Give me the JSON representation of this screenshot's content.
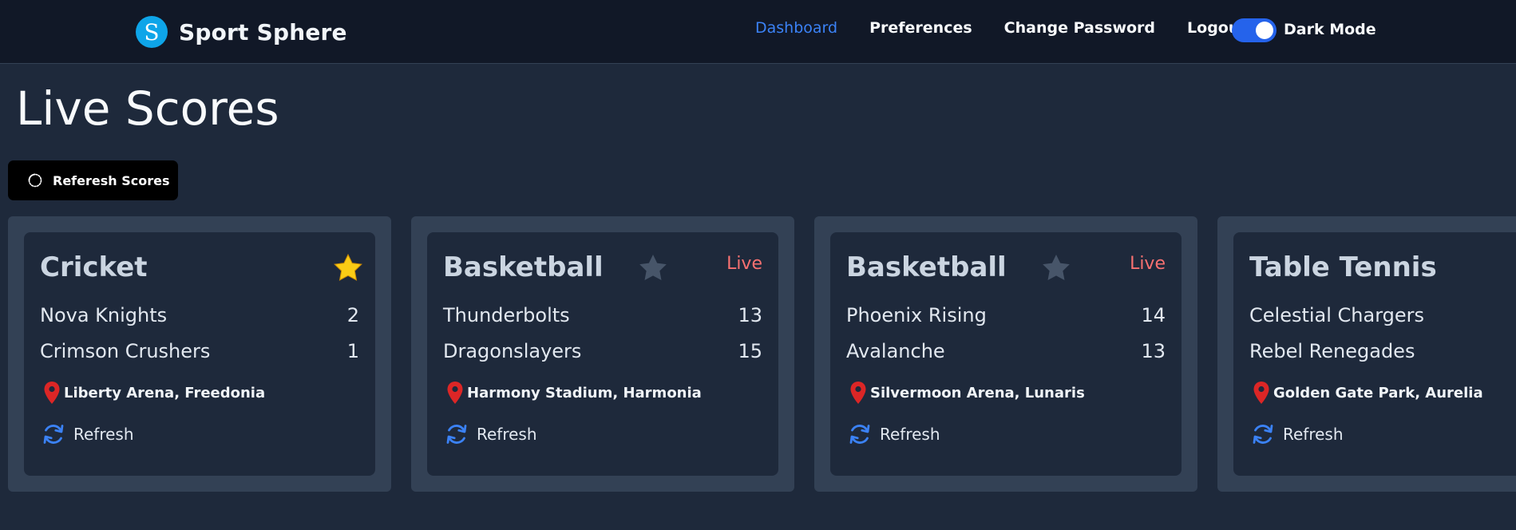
{
  "navbar": {
    "logo_letter": "S",
    "brand": "Sport Sphere",
    "links": [
      "Dashboard",
      "Preferences",
      "Change Password",
      "Logout"
    ],
    "active_link": "Dashboard",
    "dark_mode_label": "Dark Mode",
    "dark_mode_on": true
  },
  "page": {
    "title": "Live Scores",
    "refresh_button": "Referesh Scores"
  },
  "colors": {
    "background": "#1e293b",
    "navbar": "#111827",
    "accent": "#3b82f6",
    "live": "#f87171",
    "favorite_star": "#facc15",
    "star_inactive": "#475569",
    "pin": "#dc2626",
    "refresh_icon": "#3b82f6"
  },
  "cards": [
    {
      "sport": "Cricket",
      "favorite": true,
      "live_label": "",
      "teams": [
        {
          "name": "Nova Knights",
          "score": "2"
        },
        {
          "name": "Crimson Crushers",
          "score": "1"
        }
      ],
      "venue": "Liberty Arena, Freedonia",
      "refresh_label": "Refresh"
    },
    {
      "sport": "Basketball",
      "favorite": false,
      "live_label": "Live",
      "teams": [
        {
          "name": "Thunderbolts",
          "score": "13"
        },
        {
          "name": "Dragonslayers",
          "score": "15"
        }
      ],
      "venue": "Harmony Stadium, Harmonia",
      "refresh_label": "Refresh"
    },
    {
      "sport": "Basketball",
      "favorite": false,
      "live_label": "Live",
      "teams": [
        {
          "name": "Phoenix Rising",
          "score": "14"
        },
        {
          "name": "Avalanche",
          "score": "13"
        }
      ],
      "venue": "Silvermoon Arena, Lunaris",
      "refresh_label": "Refresh"
    },
    {
      "sport": "Table Tennis",
      "favorite": false,
      "live_label": "",
      "teams": [
        {
          "name": "Celestial Chargers",
          "score": ""
        },
        {
          "name": "Rebel Renegades",
          "score": ""
        }
      ],
      "venue": "Golden Gate Park, Aurelia",
      "refresh_label": "Refresh"
    }
  ]
}
